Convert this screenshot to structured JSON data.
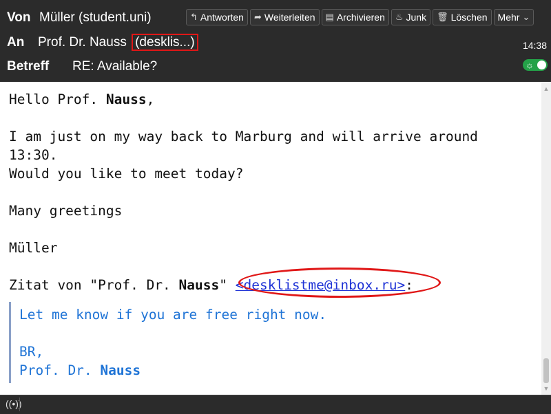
{
  "header": {
    "from_label": "Von",
    "from_value": "Müller (student.uni)",
    "to_label": "An",
    "to_name": "Prof. Dr. Nauss",
    "to_address": "(desklis...)",
    "subject_label": "Betreff",
    "subject_value": "RE: Available?",
    "time": "14:38"
  },
  "toolbar": {
    "reply": "Antworten",
    "forward": "Weiterleiten",
    "archive": "Archivieren",
    "junk": "Junk",
    "delete": "Löschen",
    "more": "Mehr"
  },
  "message": {
    "greeting_prefix": "Hello Prof. ",
    "greeting_name": "Nauss",
    "greeting_suffix": ",",
    "line1": "I am just on my way back to Marburg and will arrive around",
    "line2": "13:30.",
    "line3": "Would you like to meet today?",
    "line4": "Many greetings",
    "line5": "Müller",
    "quote_intro_prefix": "Zitat von \"Prof. Dr. ",
    "quote_intro_name": "Nauss",
    "quote_intro_quote": "\"",
    "quote_intro_link": "<desklistme@inbox.ru>",
    "quote_intro_suffix": ":",
    "quote_line1": "Let me know if you are free right now.",
    "quote_line2": "BR,",
    "quote_line3_prefix": "Prof. Dr. ",
    "quote_line3_name": "Nauss"
  },
  "icons": {
    "reply": "reply-icon",
    "forward": "forward-icon",
    "archive": "archive-icon",
    "junk": "junk-icon",
    "delete": "trash-icon",
    "more": "chevron-down-icon",
    "status": "wifi-icon"
  },
  "colors": {
    "header_bg": "#2b2b2b",
    "highlight_red": "#e01717",
    "link_blue": "#1f33d6",
    "quote_blue": "#1f74d6",
    "toggle_green": "#24a148"
  }
}
